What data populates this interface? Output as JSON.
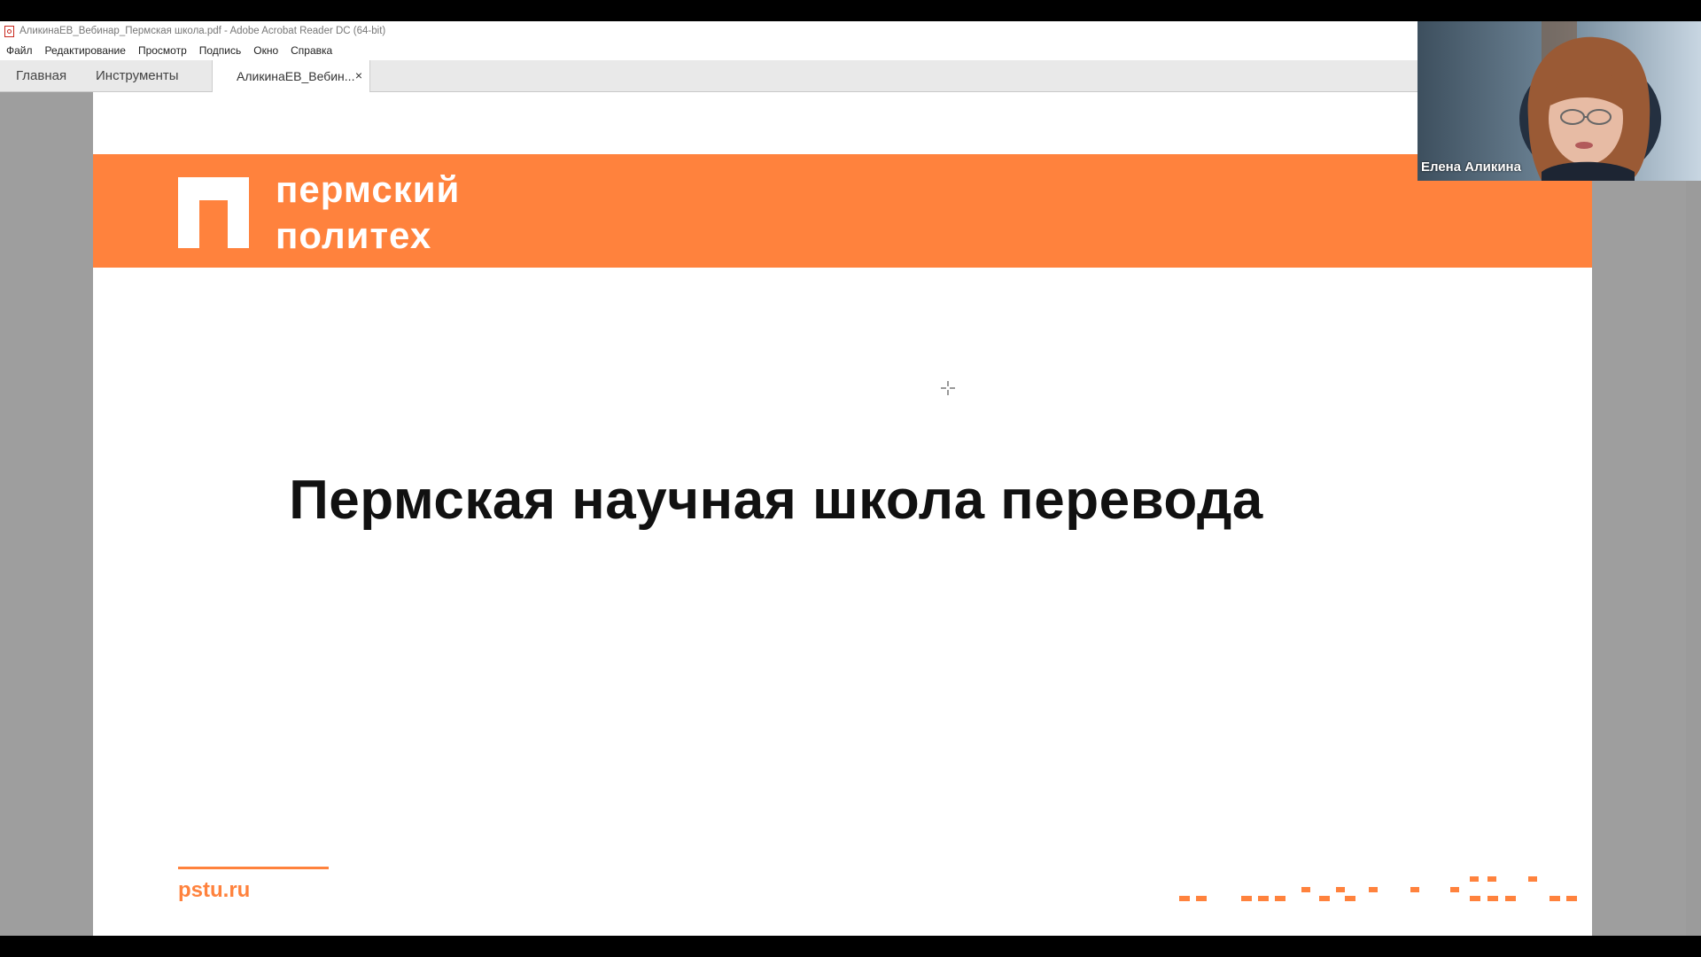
{
  "window": {
    "title": "АликинаЕВ_Вебинар_Пермская школа.pdf - Adobe Acrobat Reader DC (64-bit)"
  },
  "menu": {
    "items": [
      "Файл",
      "Редактирование",
      "Просмотр",
      "Подпись",
      "Окно",
      "Справка"
    ]
  },
  "tabs": {
    "home_label": "Главная",
    "tools_label": "Инструменты",
    "document_label": "АликинаЕВ_Вебин...",
    "close_glyph": "×"
  },
  "slide": {
    "logo_line1": "пермский",
    "logo_line2": "политех",
    "title": "Пермская научная школа перевода",
    "footer_url": "pstu.ru",
    "accent_color": "#ff823d"
  },
  "video": {
    "participant_name": "Елена Аликина"
  },
  "icons": {
    "file_icon": "pdf-file-icon",
    "cursor": "crosshair-cursor-icon"
  }
}
